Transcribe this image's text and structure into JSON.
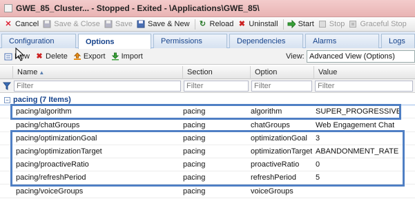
{
  "window": {
    "title": "GWE_85_Cluster... - Stopped - Exited - \\Applications\\GWE_85\\"
  },
  "toolbar": {
    "buttons": [
      {
        "label": "Cancel",
        "icon": "cancel-icon",
        "enabled": true
      },
      {
        "label": "Save & Close",
        "icon": "save-close-icon",
        "enabled": false
      },
      {
        "label": "Save",
        "icon": "save-icon",
        "enabled": false
      },
      {
        "label": "Save & New",
        "icon": "save-new-icon",
        "enabled": true
      },
      {
        "label": "Reload",
        "icon": "reload-icon",
        "enabled": true
      },
      {
        "label": "Uninstall",
        "icon": "uninstall-icon",
        "enabled": true
      },
      {
        "label": "Start",
        "icon": "start-icon",
        "enabled": true
      },
      {
        "label": "Stop",
        "icon": "stop-icon",
        "enabled": false
      },
      {
        "label": "Graceful Stop",
        "icon": "graceful-stop-icon",
        "enabled": false
      }
    ]
  },
  "tabs": [
    {
      "label": "Configuration",
      "active": false
    },
    {
      "label": "Options",
      "active": true
    },
    {
      "label": "Permissions",
      "active": false
    },
    {
      "label": "Dependencies",
      "active": false
    },
    {
      "label": "Alarms",
      "active": false
    },
    {
      "label": "Logs",
      "active": false
    }
  ],
  "subtoolbar": {
    "new_label": "New",
    "delete_label": "Delete",
    "export_label": "Export",
    "import_label": "Import",
    "view_label": "View:",
    "view_value": "Advanced View (Options)"
  },
  "grid": {
    "columns": [
      {
        "label": "Name",
        "sorted": "asc"
      },
      {
        "label": "Section"
      },
      {
        "label": "Option"
      },
      {
        "label": "Value"
      }
    ],
    "filter_placeholder": "Filter",
    "group": {
      "label": "pacing (7 Items)"
    },
    "rows": [
      {
        "name": "pacing/algorithm",
        "section": "pacing",
        "option": "algorithm",
        "value": "SUPER_PROGRESSIVE"
      },
      {
        "name": "pacing/chatGroups",
        "section": "pacing",
        "option": "chatGroups",
        "value": "Web Engagement Chat"
      },
      {
        "name": "pacing/optimizationGoal",
        "section": "pacing",
        "option": "optimizationGoal",
        "value": "3"
      },
      {
        "name": "pacing/optimizationTarget",
        "section": "pacing",
        "option": "optimizationTarget",
        "value": "ABANDONMENT_RATE"
      },
      {
        "name": "pacing/proactiveRatio",
        "section": "pacing",
        "option": "proactiveRatio",
        "value": "0"
      },
      {
        "name": "pacing/refreshPeriod",
        "section": "pacing",
        "option": "refreshPeriod",
        "value": "5"
      },
      {
        "name": "pacing/voiceGroups",
        "section": "pacing",
        "option": "voiceGroups",
        "value": ""
      }
    ]
  },
  "colors": {
    "title_bar": "#efc3c3",
    "highlight_border": "#4f7fc4",
    "group_text": "#15428b"
  }
}
